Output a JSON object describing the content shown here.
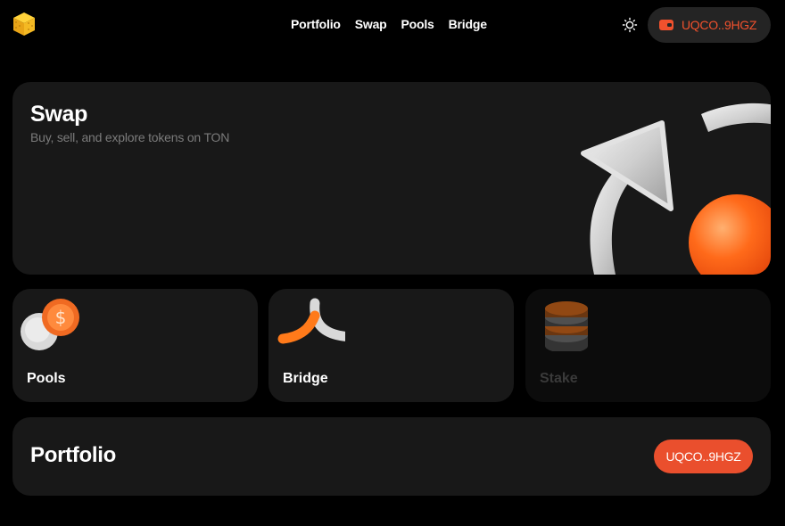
{
  "header": {
    "logo_icon": "cube-logo-icon",
    "nav": [
      {
        "label": "Portfolio"
      },
      {
        "label": "Swap"
      },
      {
        "label": "Pools"
      },
      {
        "label": "Bridge"
      }
    ],
    "theme_icon": "sun-icon",
    "wallet": {
      "icon": "wallet-icon",
      "address": "UQCO..9HGZ"
    }
  },
  "swap": {
    "title": "Swap",
    "subtitle": "Buy, sell, and explore tokens on TON"
  },
  "tiles": [
    {
      "label": "Pools",
      "icon": "coins-icon"
    },
    {
      "label": "Bridge",
      "icon": "bridge-icon"
    },
    {
      "label": "Stake",
      "icon": "stacked-coins-icon",
      "disabled": true
    }
  ],
  "portfolio": {
    "title": "Portfolio",
    "address": "UQCO..9HGZ"
  },
  "colors": {
    "accent": "#f0512d",
    "background": "#000000",
    "card": "#181818",
    "muted": "#7b7b7b"
  }
}
